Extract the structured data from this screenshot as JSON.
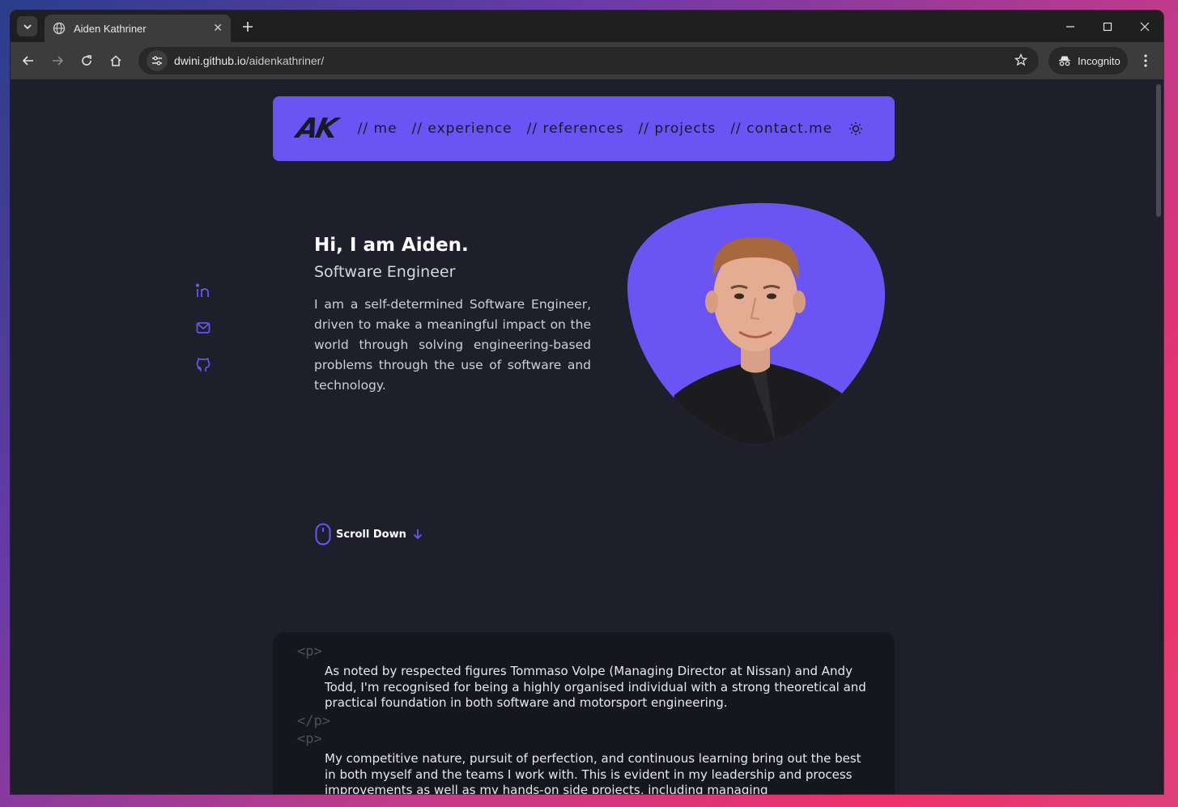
{
  "browser": {
    "tab_title": "Aiden Kathriner",
    "url_domain": "dwini.github.io",
    "url_path": "/aidenkathriner/",
    "incognito_label": "Incognito"
  },
  "nav": {
    "logo": "AK",
    "links": [
      "// me",
      "// experience",
      "// references",
      "// projects",
      "// contact.me"
    ]
  },
  "hero": {
    "greeting": "Hi, I am Aiden.",
    "role": "Software Engineer",
    "bio": "I am a self-determined Software Engineer, driven to make a meaningful impact on the world through solving engineering-based problems through the use of software and technology.",
    "scroll_label": "Scroll Down"
  },
  "about": {
    "open_tag": "<p>",
    "close_tag": "</p>",
    "paragraphs": [
      "As noted by respected figures Tommaso Volpe (Managing Director at Nissan) and Andy Todd, I'm recognised for being a highly organised individual with a strong theoretical and practical foundation in both software and motorsport engineering.",
      "My competitive nature, pursuit of perfection, and continuous learning bring out the best in both myself and the teams I work with. This is evident in my leadership and process improvements as well as my hands-on side projects, including managing"
    ]
  },
  "colors": {
    "accent": "#6a55f4",
    "background": "#1e1f2b",
    "card": "#16161f"
  }
}
